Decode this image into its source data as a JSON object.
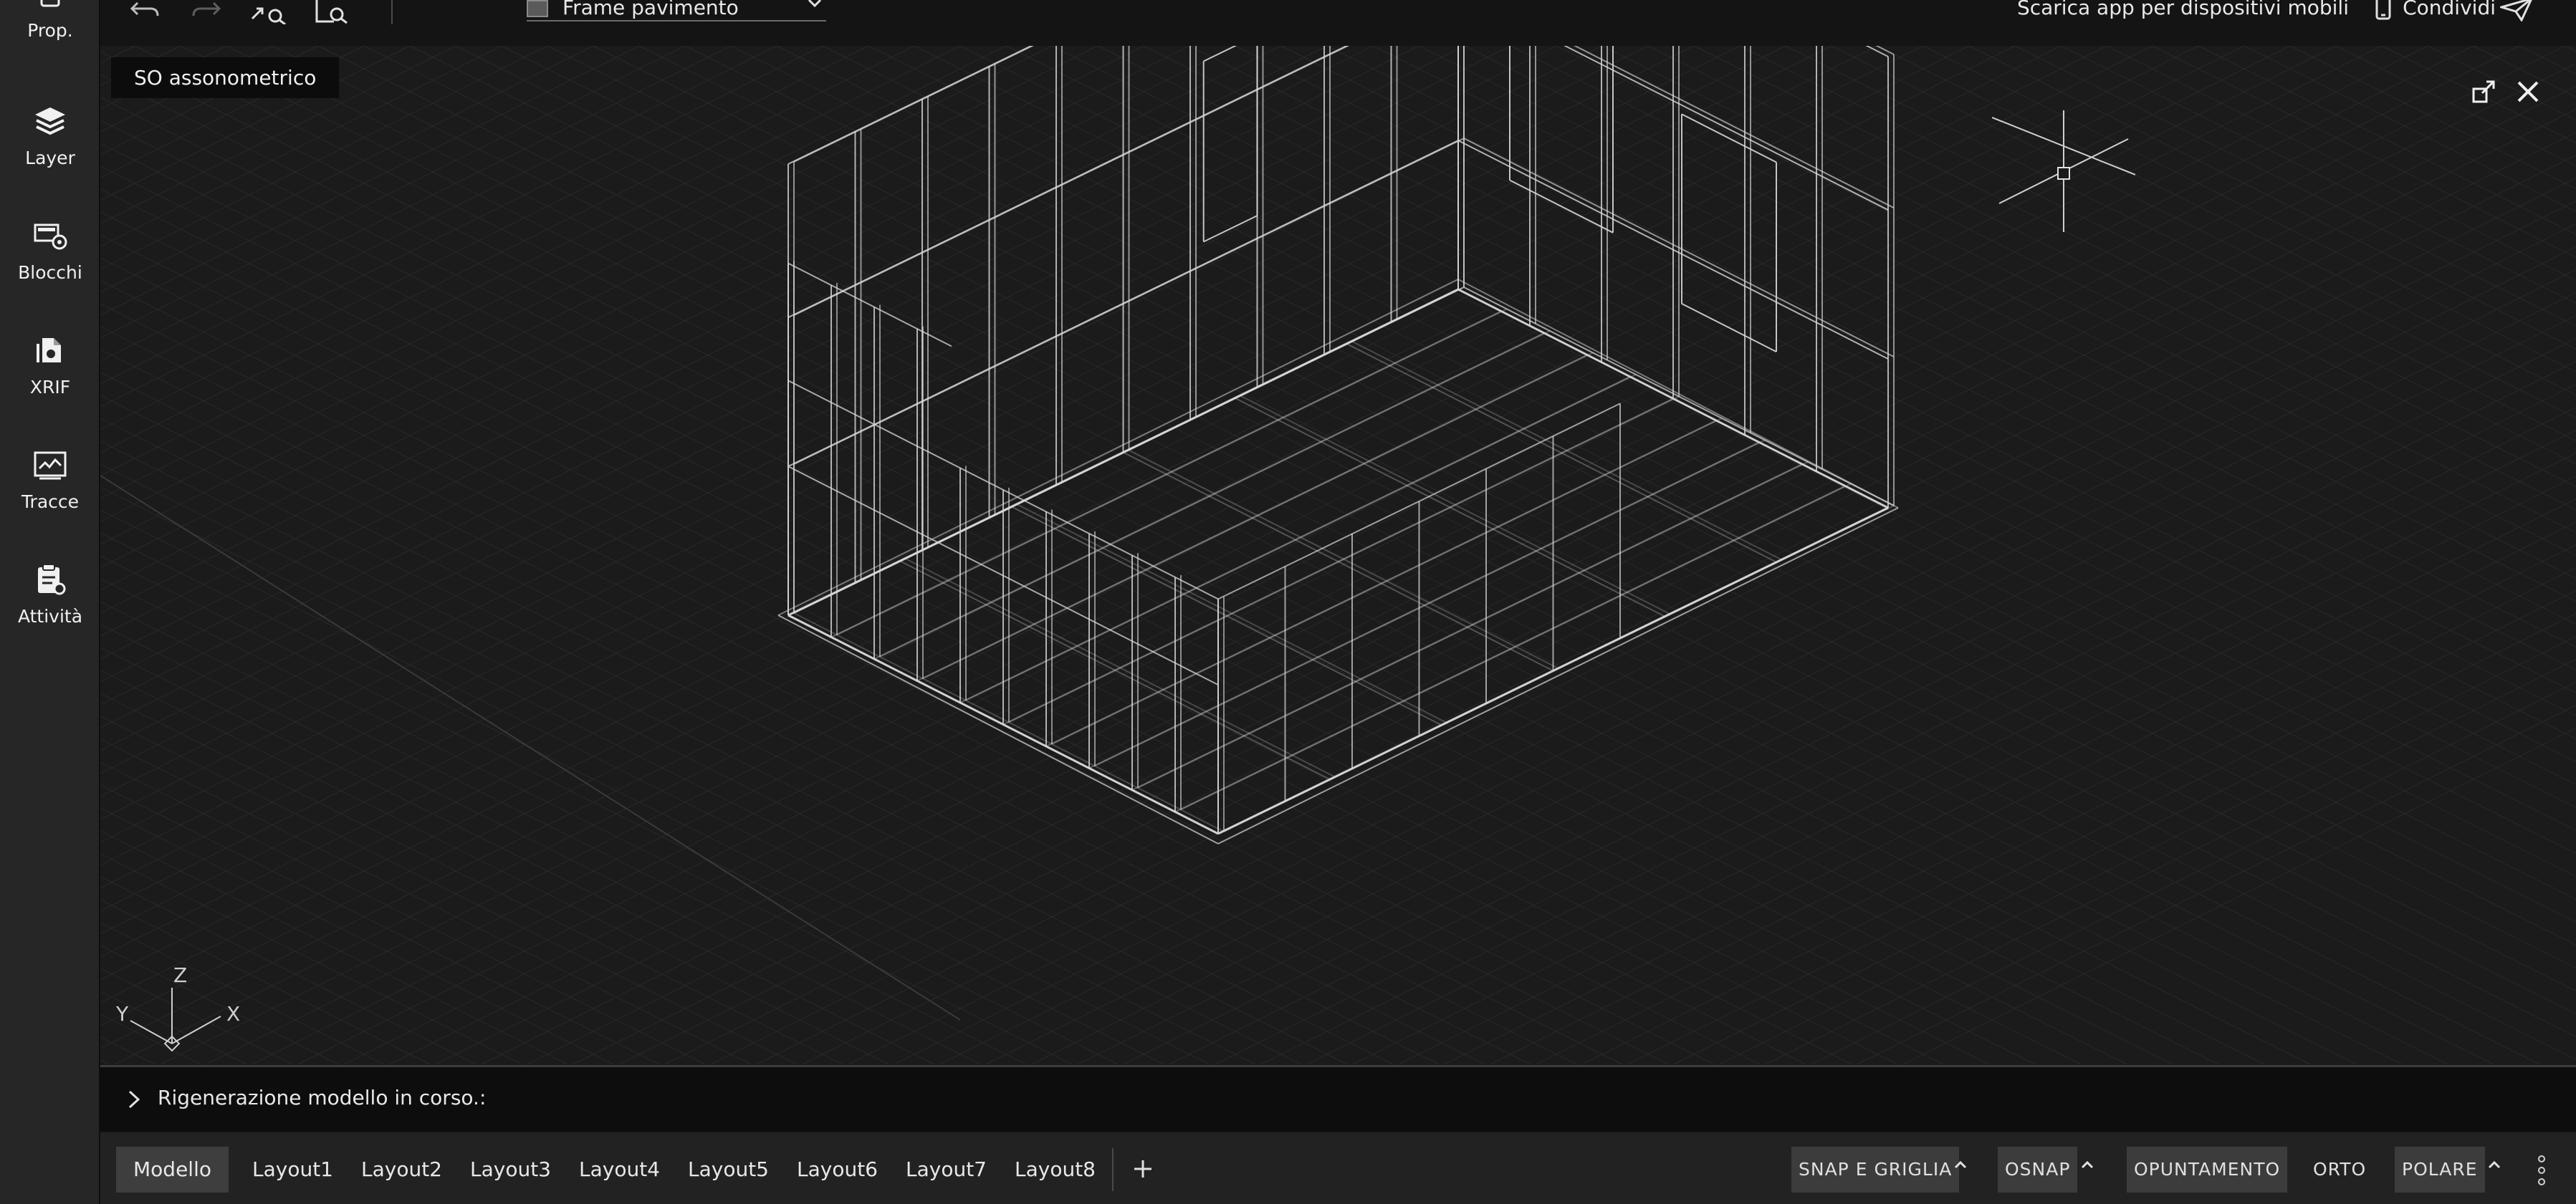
{
  "sidebar": {
    "items": [
      {
        "label": "Prop.",
        "icon": "properties-icon"
      },
      {
        "label": "Layer",
        "icon": "layers-icon"
      },
      {
        "label": "Blocchi",
        "icon": "blocks-icon"
      },
      {
        "label": "XRIF",
        "icon": "xref-icon"
      },
      {
        "label": "Tracce",
        "icon": "traces-icon"
      },
      {
        "label": "Attività",
        "icon": "activity-icon"
      }
    ]
  },
  "topbar": {
    "icons": [
      "undo-icon",
      "redo-icon",
      "zoom-extents-icon",
      "zoom-window-icon"
    ],
    "layer_selector": {
      "value": "Frame pavimento",
      "swatch_color": "#5a5a5a"
    },
    "mobile_app_label": "Scarica app per dispositivi mobili",
    "share_label": "Condividi"
  },
  "viewport": {
    "view_label": "SO assonometrico",
    "icons": [
      "maximize-viewport-icon",
      "close-viewport-icon",
      "crosshair-cursor-icon",
      "ucs-axes-icon"
    ],
    "ucs_axes": {
      "x": "X",
      "y": "Y",
      "z": "Z"
    }
  },
  "command_line": {
    "text": "Rigenerazione modello in corso.:"
  },
  "tabs": {
    "items": [
      "Modello",
      "Layout1",
      "Layout2",
      "Layout3",
      "Layout4",
      "Layout5",
      "Layout6",
      "Layout7",
      "Layout8"
    ],
    "active": "Modello"
  },
  "status": {
    "snap": "SNAP E GRIGLIA",
    "osnap": "OSNAP",
    "tracking": "OPUNTAMENTO",
    "ortho": "ORTO",
    "polar": "POLARE"
  },
  "colors": {
    "background": "#1b1b1b",
    "sidebar": "#262626",
    "wireframe": "#d8d8d8",
    "grid": "#2a2a2a"
  }
}
